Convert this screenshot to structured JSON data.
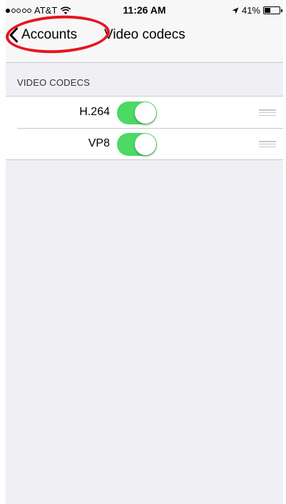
{
  "status_bar": {
    "carrier": "AT&T",
    "signal_bars_filled": 1,
    "signal_bars_total": 5,
    "time": "11:26 AM",
    "battery_percent": "41%",
    "battery_level": 0.41,
    "icons": [
      "wifi-icon",
      "location-arrow-icon",
      "battery-icon"
    ]
  },
  "nav": {
    "back_label": "Accounts",
    "title": "Video codecs",
    "back_icon": "chevron-left-icon"
  },
  "section": {
    "header": "VIDEO CODECS"
  },
  "codecs": [
    {
      "label": "H.264",
      "enabled": true
    },
    {
      "label": "VP8",
      "enabled": true
    }
  ],
  "colors": {
    "toggle_on": "#4cd964",
    "highlight_circle": "#e8141c",
    "background": "#efeff4"
  }
}
